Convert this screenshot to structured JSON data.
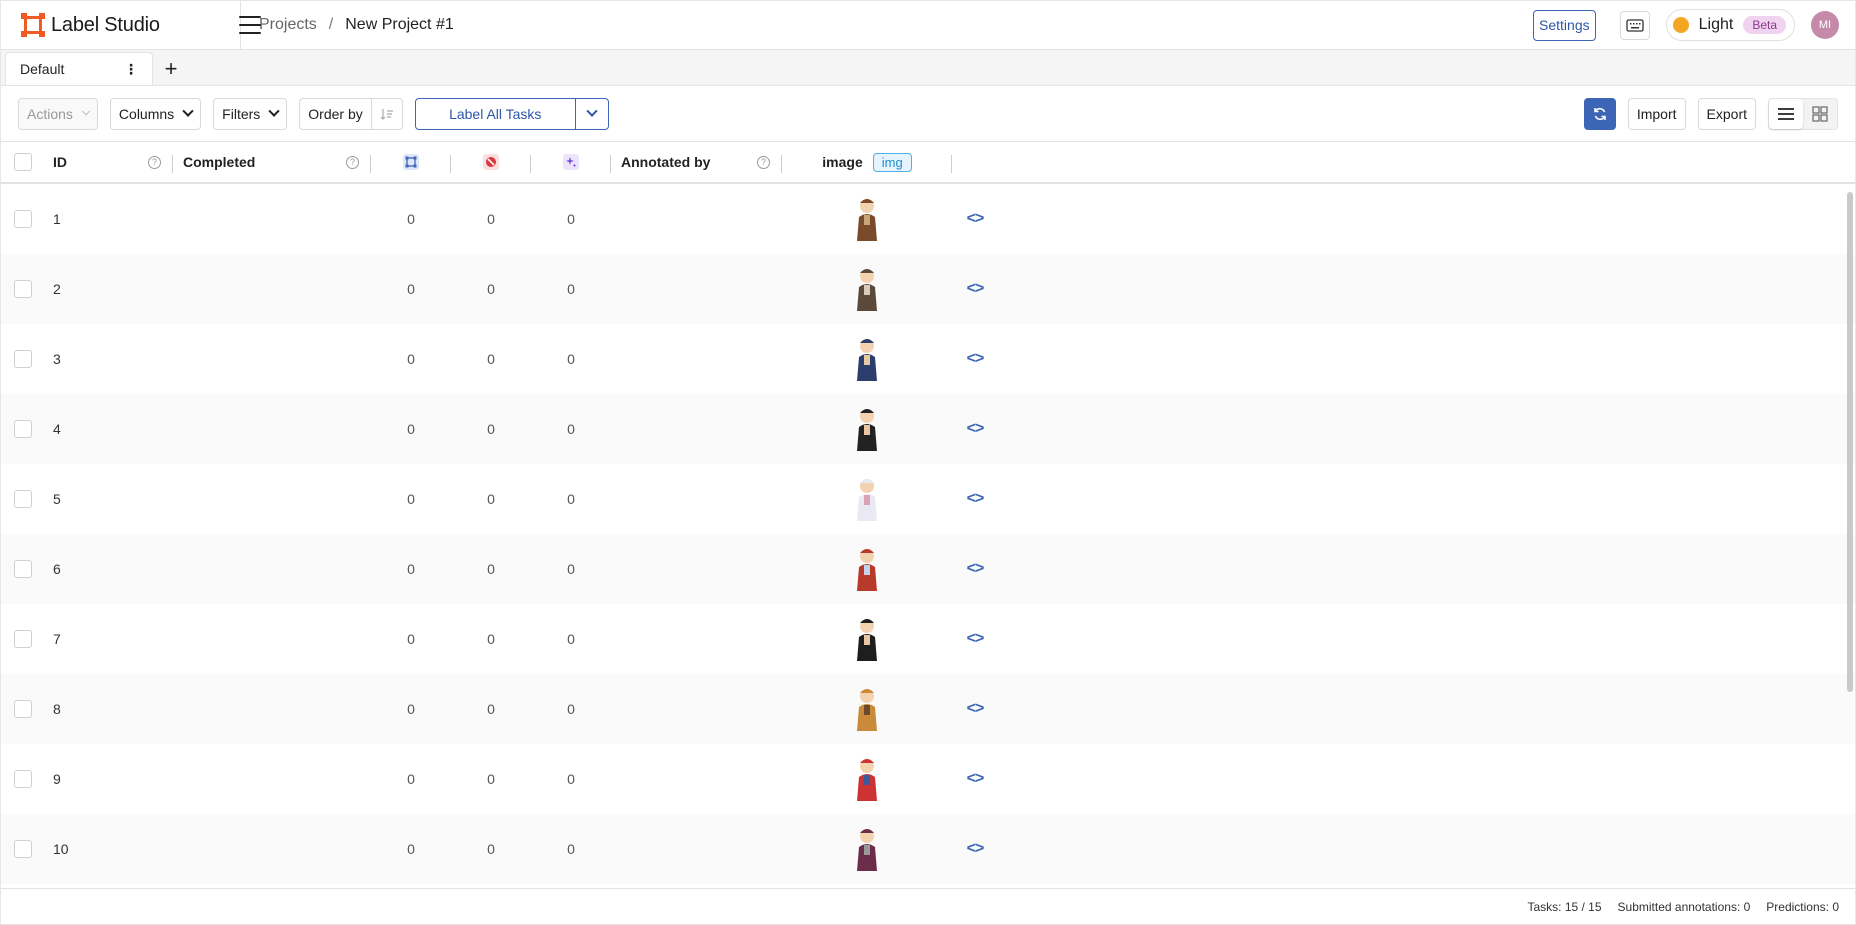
{
  "app": {
    "brand": "Label Studio",
    "brand_color": "#f15a24"
  },
  "breadcrumb": {
    "projects": "Projects",
    "separator": "/",
    "current": "New Project #1"
  },
  "header": {
    "settings_label": "Settings",
    "theme_label": "Light",
    "beta_label": "Beta",
    "avatar_initials": "MI"
  },
  "tabs": {
    "items": [
      {
        "label": "Default"
      }
    ],
    "add": "+"
  },
  "toolbar": {
    "actions_label": "Actions",
    "columns_label": "Columns",
    "filters_label": "Filters",
    "order_by_label": "Order by",
    "label_all_label": "Label All Tasks",
    "import_label": "Import",
    "export_label": "Export"
  },
  "table": {
    "headers": {
      "id": "ID",
      "completed": "Completed",
      "annotated_by": "Annotated by",
      "image": "image",
      "image_tag": "img"
    },
    "rows": [
      {
        "id": "1",
        "total": "0",
        "cancelled": "0",
        "predictions": "0"
      },
      {
        "id": "2",
        "total": "0",
        "cancelled": "0",
        "predictions": "0"
      },
      {
        "id": "3",
        "total": "0",
        "cancelled": "0",
        "predictions": "0"
      },
      {
        "id": "4",
        "total": "0",
        "cancelled": "0",
        "predictions": "0"
      },
      {
        "id": "5",
        "total": "0",
        "cancelled": "0",
        "predictions": "0"
      },
      {
        "id": "6",
        "total": "0",
        "cancelled": "0",
        "predictions": "0"
      },
      {
        "id": "7",
        "total": "0",
        "cancelled": "0",
        "predictions": "0"
      },
      {
        "id": "8",
        "total": "0",
        "cancelled": "0",
        "predictions": "0"
      },
      {
        "id": "9",
        "total": "0",
        "cancelled": "0",
        "predictions": "0"
      },
      {
        "id": "10",
        "total": "0",
        "cancelled": "0",
        "predictions": "0"
      }
    ],
    "code_glyph": "<>"
  },
  "footer": {
    "tasks": "Tasks: 15 / 15",
    "submitted": "Submitted annotations: 0",
    "predictions": "Predictions: 0"
  },
  "colors": {
    "accent": "#3c65b5",
    "img_tag": "#1b8fd4"
  }
}
